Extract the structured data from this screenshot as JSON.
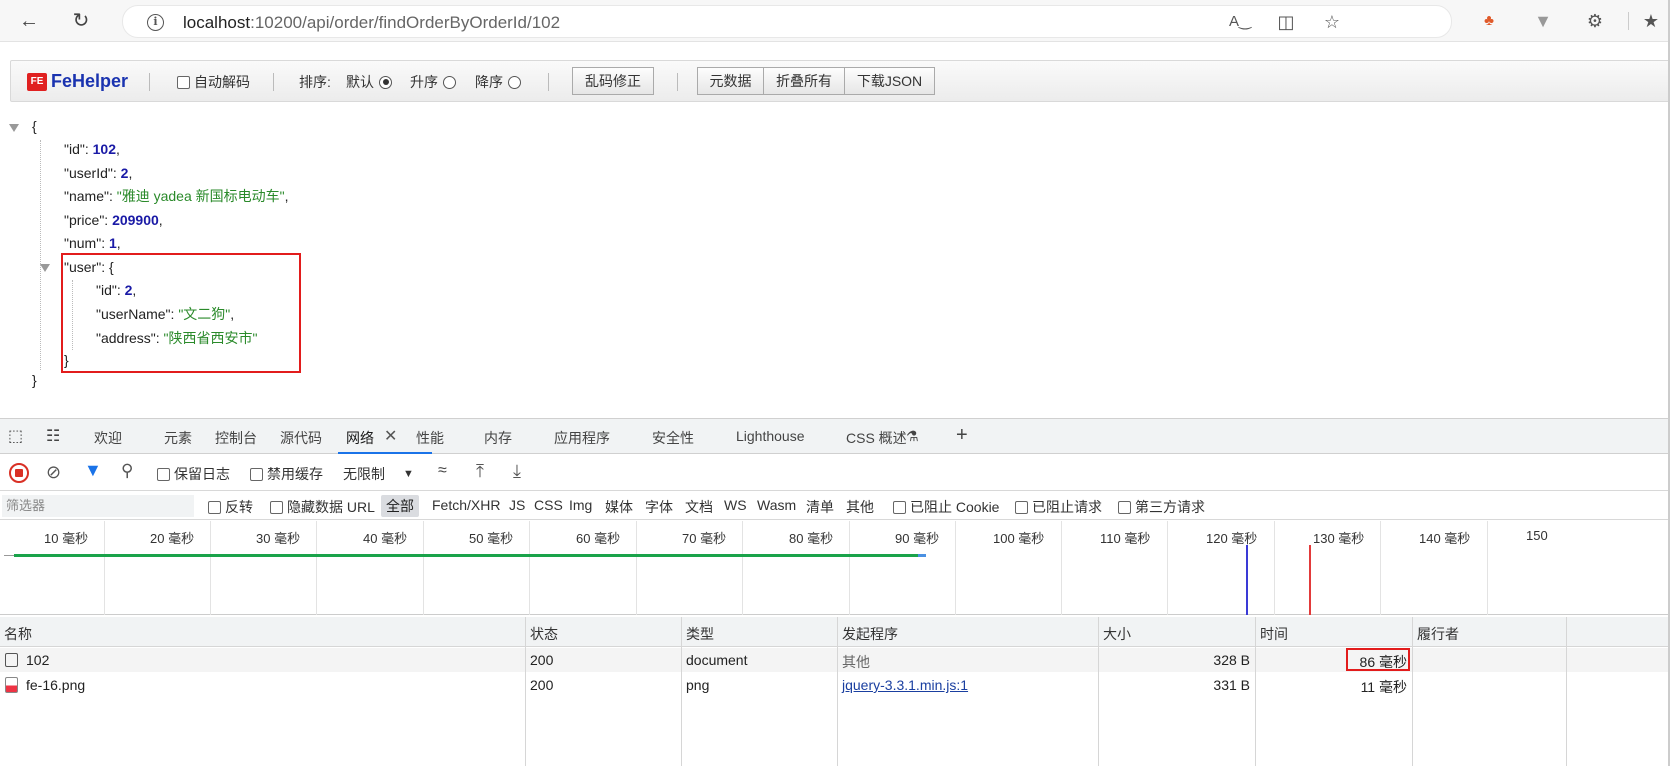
{
  "browser": {
    "url_host": "localhost",
    "url_path": ":10200/api/order/findOrderByOrderId/102"
  },
  "fehelper": {
    "logo_badge": "FE",
    "logo_text": "FeHelper",
    "auto_decode_label": "自动解码",
    "sort_label": "排序:",
    "sort_default": "默认",
    "sort_asc": "升序",
    "sort_desc": "降序",
    "btn_fix_garbled": "乱码修正",
    "btn_metadata": "元数据",
    "btn_collapse_all": "折叠所有",
    "btn_download_json": "下载JSON"
  },
  "json": {
    "open_brace": "{",
    "close_brace": "}",
    "id_key": "\"id\"",
    "id_val": "102",
    "userId_key": "\"userId\"",
    "userId_val": "2",
    "name_key": "\"name\"",
    "name_val": "\"雅迪 yadea 新国标电动车\"",
    "price_key": "\"price\"",
    "price_val": "209900",
    "num_key": "\"num\"",
    "num_val": "1",
    "user_key": "\"user\"",
    "user_open": "{",
    "user_close": "}",
    "user_id_key": "\"id\"",
    "user_id_val": "2",
    "user_name_key": "\"userName\"",
    "user_name_val": "\"文二狗\"",
    "user_address_key": "\"address\"",
    "user_address_val": "\"陕西省西安市\""
  },
  "devtools": {
    "tabs": [
      "欢迎",
      "元素",
      "控制台",
      "源代码",
      "网络",
      "性能",
      "内存",
      "应用程序",
      "安全性",
      "Lighthouse",
      "CSS 概述"
    ],
    "active_tab": "网络",
    "network_toolbar": {
      "preserve_log": "保留日志",
      "disable_cache": "禁用缓存",
      "throttle": "无限制"
    },
    "filter": {
      "placeholder": "筛选器",
      "invert": "反转",
      "hide_data_url": "隐藏数据 URL",
      "all": "全部",
      "types": [
        "Fetch/XHR",
        "JS",
        "CSS",
        "Img",
        "媒体",
        "字体",
        "文档",
        "WS",
        "Wasm",
        "清单",
        "其他"
      ],
      "blocked_cookies": "已阻止 Cookie",
      "blocked_requests": "已阻止请求",
      "third_party": "第三方请求"
    },
    "timeline_ticks": [
      "10 毫秒",
      "20 毫秒",
      "30 毫秒",
      "40 毫秒",
      "50 毫秒",
      "60 毫秒",
      "70 毫秒",
      "80 毫秒",
      "90 毫秒",
      "100 毫秒",
      "110 毫秒",
      "120 毫秒",
      "130 毫秒",
      "140 毫秒",
      "150"
    ],
    "table": {
      "headers": [
        "名称",
        "状态",
        "类型",
        "发起程序",
        "大小",
        "时间",
        "履行者"
      ],
      "rows": [
        {
          "name": "102",
          "status": "200",
          "type": "document",
          "initiator": "其他",
          "size": "328 B",
          "time": "86 毫秒"
        },
        {
          "name": "fe-16.png",
          "status": "200",
          "type": "png",
          "initiator": "jquery-3.3.1.min.js:1",
          "size": "331 B",
          "time": "11 毫秒"
        }
      ]
    }
  },
  "colors": {
    "json_number": "#1a1aa6",
    "json_string": "#2a8a2a",
    "highlight_box": "#e21c1c",
    "active_tab_underline": "#1a73e8"
  }
}
